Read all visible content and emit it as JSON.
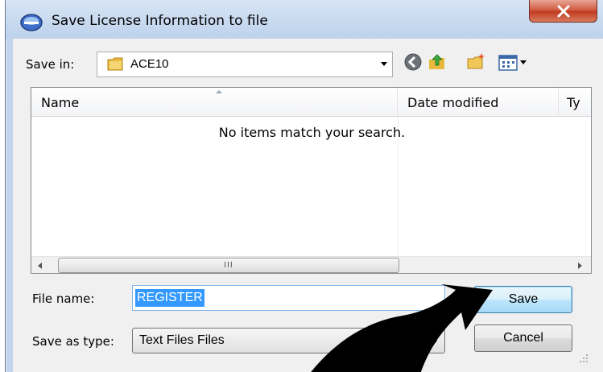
{
  "window": {
    "title": "Save License Information to file",
    "close_label": "X"
  },
  "toolbar": {
    "save_in_label": "Save in:",
    "save_in_value": "ACE10",
    "icons": [
      "back-icon",
      "up-folder-icon",
      "new-folder-icon",
      "view-menu-icon"
    ]
  },
  "file_list": {
    "columns": [
      "Name",
      "Date modified",
      "Ty"
    ],
    "empty_message": "No items match your search.",
    "scroll_grip": "III"
  },
  "file_name": {
    "label": "File name:",
    "value": "REGISTER"
  },
  "save_as_type": {
    "label": "Save as type:",
    "value": "Text Files Files"
  },
  "buttons": {
    "save_label": "Save",
    "cancel_label": "Cancel"
  },
  "colors": {
    "selection": "#3399ff",
    "title_bar": "#c2d5ec",
    "close_button": "#c0381d",
    "overlay_arrow": "#000000"
  }
}
